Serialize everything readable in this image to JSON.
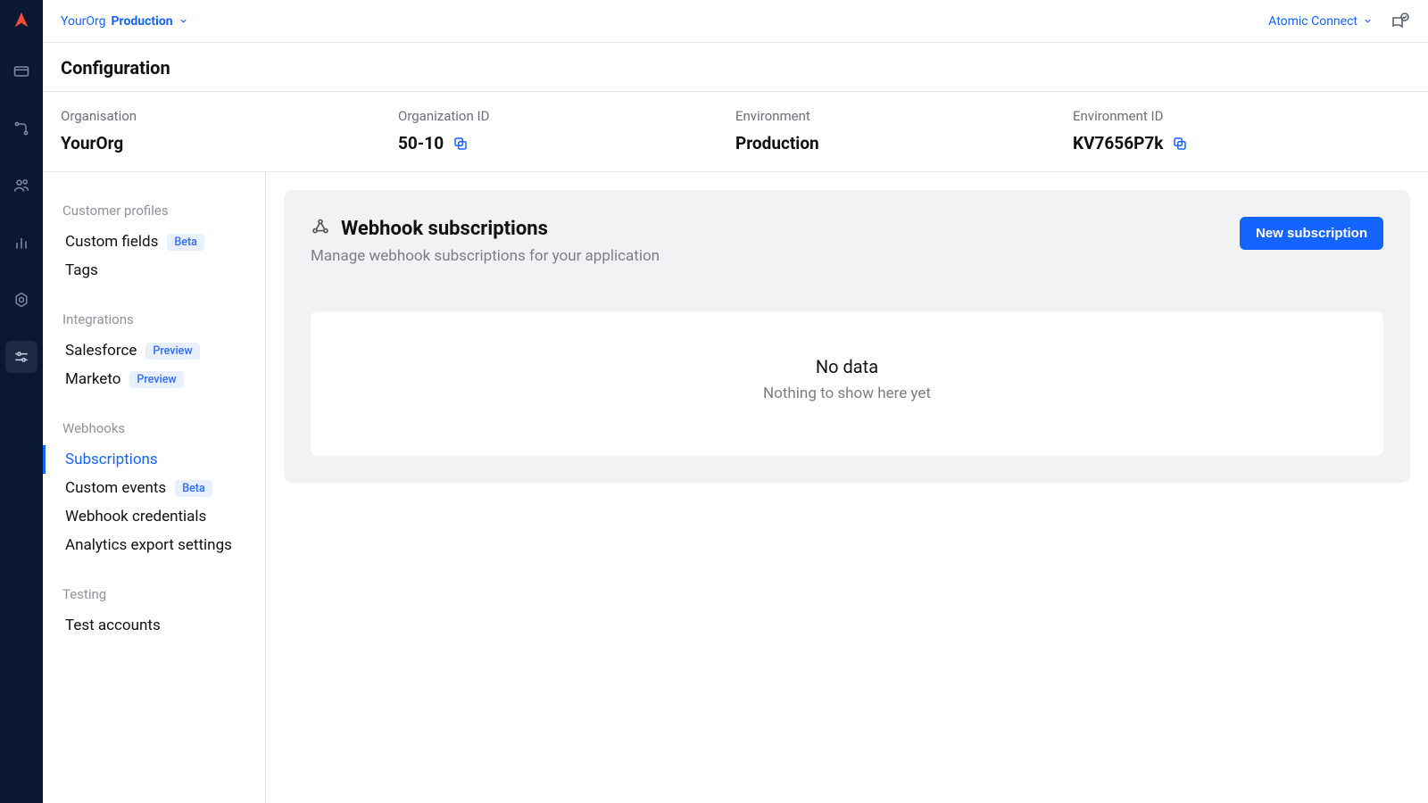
{
  "topbar": {
    "org": "YourOrg",
    "env": "Production",
    "connect": "Atomic Connect"
  },
  "page": {
    "title": "Configuration"
  },
  "info": {
    "org_label": "Organisation",
    "org_value": "YourOrg",
    "orgid_label": "Organization ID",
    "orgid_value": "50-10",
    "env_label": "Environment",
    "env_value": "Production",
    "envid_label": "Environment ID",
    "envid_value": "KV7656P7k"
  },
  "sidebar": {
    "groups": [
      {
        "head": "Customer profiles",
        "items": [
          {
            "label": "Custom fields",
            "badge": "Beta"
          },
          {
            "label": "Tags"
          }
        ]
      },
      {
        "head": "Integrations",
        "items": [
          {
            "label": "Salesforce",
            "badge": "Preview"
          },
          {
            "label": "Marketo",
            "badge": "Preview"
          }
        ]
      },
      {
        "head": "Webhooks",
        "items": [
          {
            "label": "Subscriptions",
            "active": true
          },
          {
            "label": "Custom events",
            "badge": "Beta"
          },
          {
            "label": "Webhook credentials"
          },
          {
            "label": "Analytics export settings"
          }
        ]
      },
      {
        "head": "Testing",
        "items": [
          {
            "label": "Test accounts"
          }
        ]
      }
    ]
  },
  "panel": {
    "title": "Webhook subscriptions",
    "sub": "Manage webhook subscriptions for your application",
    "new_btn": "New subscription",
    "empty_title": "No data",
    "empty_sub": "Nothing to show here yet"
  }
}
